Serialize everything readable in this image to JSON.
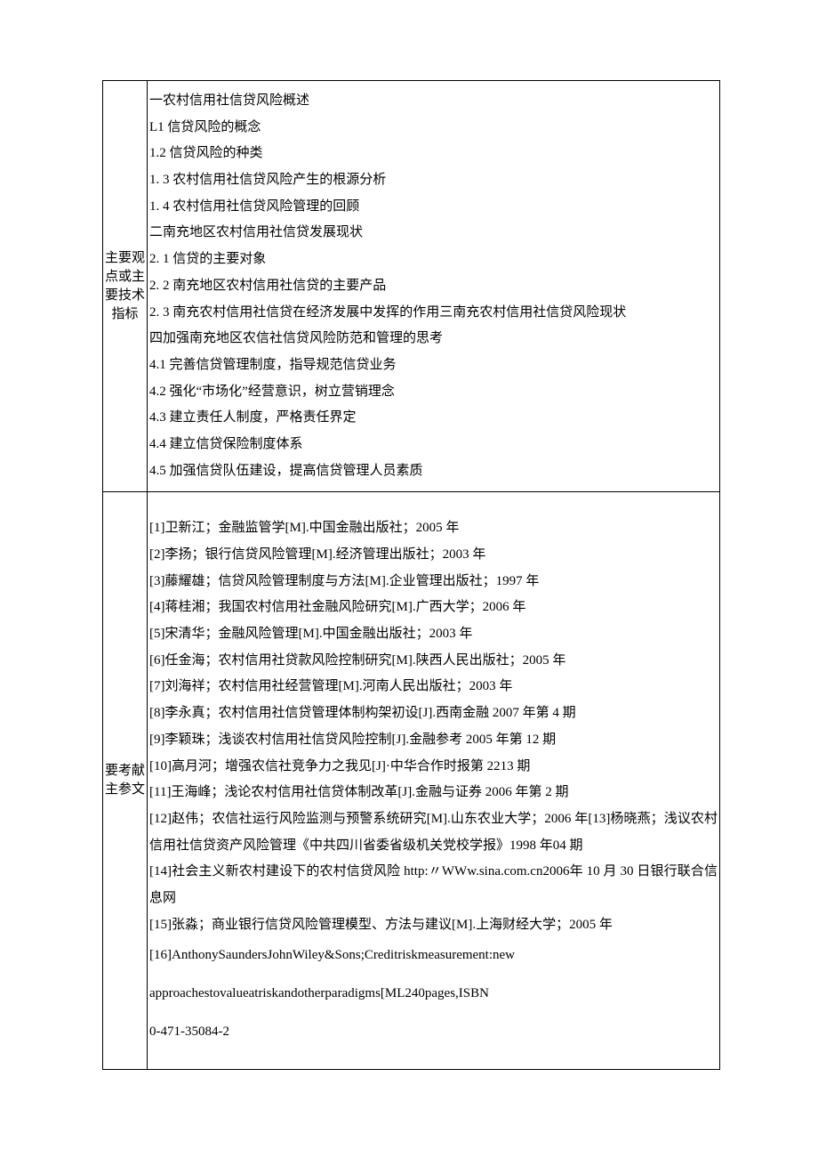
{
  "row1": {
    "label": "主要观点或主要技术指标",
    "lines": [
      "一农村信用社信贷风险概述",
      "L1 信贷风险的概念",
      "1.2 信贷风险的种类",
      "1. 3 农村信用社信贷风险产生的根源分析",
      "1. 4 农村信用社信贷风险管理的回顾",
      "二南充地区农村信用社信贷发展现状",
      "2. 1 信贷的主要对象",
      "2. 2 南充地区农村信用社信贷的主要产品",
      "2. 3 南充农村信用社信贷在经济发展中发挥的作用三南充农村信用社信贷风险现状",
      "四加强南充地区农信社信贷风险防范和管理的思考",
      "4.1 完善信贷管理制度，指导规范信贷业务",
      "4.2 强化“市场化”经营意识，树立营销理念",
      "4.3 建立责任人制度，严格责任界定",
      "4.4 建立信贷保险制度体系",
      "4.5 加强信贷队伍建设，提高信贷管理人员素质"
    ]
  },
  "row2": {
    "label": "要考献主参文",
    "refs": [
      "[1]卫新江；金融监管学[M].中国金融出版社；2005 年",
      "[2]李扬；银行信贷风险管理[M].经济管理出版社；2003 年",
      "[3]藤耀雄；信贷风险管理制度与方法[M].企业管理出版社；1997 年",
      "[4]蒋桂湘；我国农村信用社金融风险研究[M].广西大学；2006 年",
      "[5]宋清华；金融风险管理[M].中国金融出版社；2003 年",
      "[6]任金海；农村信用社贷款风险控制研究[M].陕西人民出版社；2005 年",
      "[7]刘海祥；农村信用社经营管理[M].河南人民出版社；2003 年",
      "[8]李永真；农村信用社信贷管理体制构架初设[J].西南金融 2007 年第 4 期",
      "[9]李颖珠；浅谈农村信用社信贷风险控制[J].金融参考 2005 年第 12 期",
      "[10]高月河；增强农信社竞争力之我见[J]·中华合作时报第 2213 期",
      "[11]王海峰；浅论农村信用社信贷体制改革[J].金融与证券 2006 年第 2 期",
      "[12]赵伟；农信社运行风险监测与预警系统研究[M].山东农业大学；2006 年[13]杨晓燕；浅议农村信用社信贷资产风险管理《中共四川省委省级机关党校学报》1998 年04 期",
      "[14]社会主义新农村建设下的农村信贷风险 http:〃WWw.sina.com.cn2006年 10 月 30 日银行联合信息网",
      "[15]张淼；商业银行信贷风险管理模型、方法与建议[M].上海财经大学；2005 年"
    ],
    "spaced_refs": [
      "[16]AnthonySaundersJohnWiley&Sons;Creditriskmeasurement:new",
      "approachestovalueatriskandotherparadigms[ML240pages,ISBN",
      "0-471-35084-2"
    ]
  }
}
